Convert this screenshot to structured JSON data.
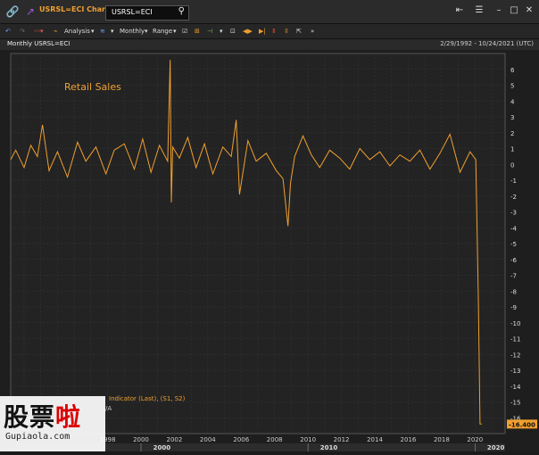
{
  "titlebar": {
    "app_title": "USRSL=ECI Chart",
    "search_value": "USRSL=ECI"
  },
  "toolbar": {
    "analysis_label": "Analysis",
    "monthly_label": "Monthly",
    "range_label": "Range"
  },
  "chart_header": {
    "left": "Monthly USRSL=ECI",
    "right": "2/29/1992 - 10/24/2021 (UTC)"
  },
  "legend": {
    "line1": "Indicator (Last), (S1, S2)",
    "line2": "/A"
  },
  "watermark": {
    "chars": "股票",
    "red_char": "啦",
    "site": "Gupiaola.com"
  },
  "chart_data": {
    "type": "line",
    "title": "Retail Sales",
    "color": "#f0a030",
    "last_value_label": "-16.400",
    "x_tick_labels": [
      "1998",
      "2000",
      "2002",
      "2004",
      "2006",
      "2008",
      "2010",
      "2012",
      "2014",
      "2016",
      "2018",
      "2020"
    ],
    "x_decade_labels": [
      "2000",
      "2010",
      "2020"
    ],
    "y_ticks": [
      6,
      5,
      4,
      3,
      2,
      1,
      0,
      -1,
      -2,
      -3,
      -4,
      -5,
      -6,
      -7,
      -8,
      -9,
      -10,
      -11,
      -12,
      -13,
      -14,
      -15,
      -16
    ],
    "ylim": [
      -17,
      7
    ],
    "xlim": [
      1992.2,
      2021.8
    ],
    "series": [
      {
        "x": [
          1992.2,
          1992.5,
          1993,
          1993.4,
          1993.8,
          1994.1,
          1994.5,
          1995,
          1995.6,
          1996.2,
          1996.7,
          1997.3,
          1997.9,
          1998.4,
          1999,
          1999.6,
          2000.1,
          2000.6,
          2001.1,
          2001.6,
          2001.75,
          2001.82,
          2001.9,
          2002.3,
          2002.8,
          2003.3,
          2003.8,
          2004.3,
          2004.9,
          2005.4,
          2005.7,
          2005.9,
          2006.4,
          2006.9,
          2007.5,
          2008.1,
          2008.5,
          2008.8,
          2008.95,
          2009.2,
          2009.7,
          2010.2,
          2010.7,
          2011.3,
          2011.9,
          2012.5,
          2013.1,
          2013.7,
          2014.3,
          2014.9,
          2015.5,
          2016.1,
          2016.7,
          2017.3,
          2017.9,
          2018.5,
          2019.1,
          2019.7,
          2020.05,
          2020.2,
          2020.3,
          2020.4
        ],
        "y": [
          0.3,
          0.9,
          -0.2,
          1.2,
          0.5,
          2.5,
          -0.4,
          0.8,
          -0.8,
          1.4,
          0.2,
          1.1,
          -0.6,
          0.9,
          1.3,
          -0.3,
          1.6,
          -0.5,
          1.2,
          0.2,
          6.6,
          -2.4,
          1.1,
          0.4,
          1.7,
          -0.2,
          1.3,
          -0.6,
          1.1,
          0.5,
          2.8,
          -1.9,
          1.5,
          0.2,
          0.7,
          -0.4,
          -0.9,
          -3.9,
          -1.2,
          0.5,
          1.8,
          0.6,
          -0.2,
          0.9,
          0.4,
          -0.3,
          1.0,
          0.3,
          0.8,
          -0.1,
          0.6,
          0.2,
          0.9,
          -0.3,
          0.7,
          1.9,
          -0.5,
          0.8,
          0.3,
          -8.7,
          -16.4,
          -16.4
        ]
      }
    ]
  }
}
